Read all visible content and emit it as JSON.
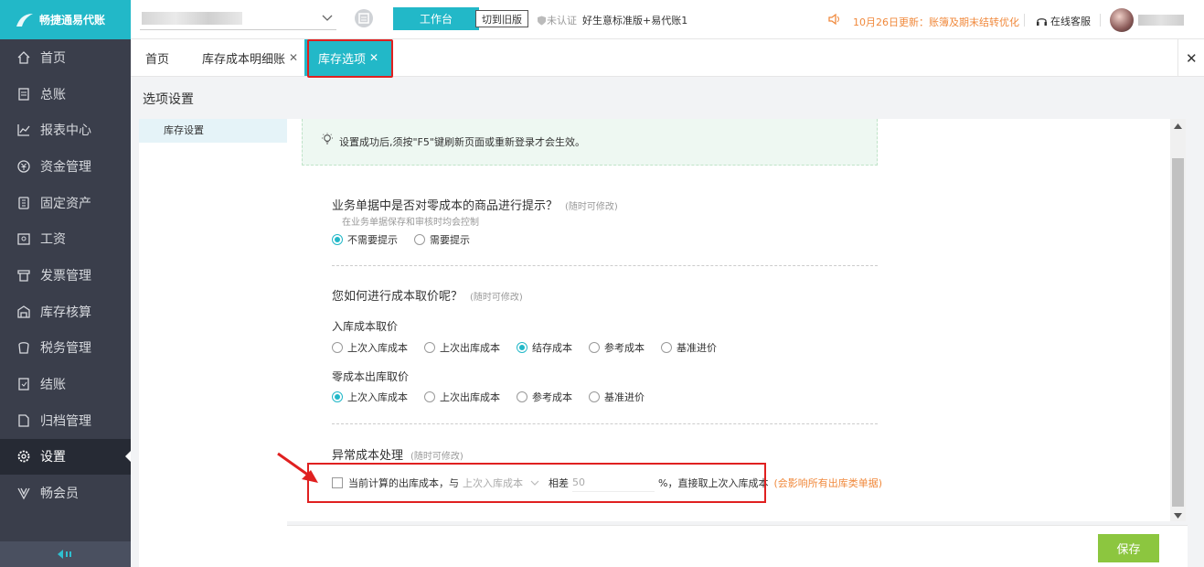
{
  "app": {
    "logo_text": "畅捷通易代账"
  },
  "sidebar": {
    "items": [
      {
        "label": "首页",
        "icon": "home-icon"
      },
      {
        "label": "总账",
        "icon": "ledger-icon"
      },
      {
        "label": "报表中心",
        "icon": "chart-icon"
      },
      {
        "label": "资金管理",
        "icon": "money-icon"
      },
      {
        "label": "固定资产",
        "icon": "asset-icon"
      },
      {
        "label": "工资",
        "icon": "salary-icon"
      },
      {
        "label": "发票管理",
        "icon": "invoice-icon"
      },
      {
        "label": "库存核算",
        "icon": "warehouse-icon"
      },
      {
        "label": "税务管理",
        "icon": "tax-icon"
      },
      {
        "label": "结账",
        "icon": "close-account-icon"
      },
      {
        "label": "归档管理",
        "icon": "archive-icon"
      },
      {
        "label": "设置",
        "icon": "gear-icon",
        "active": true
      },
      {
        "label": "畅会员",
        "icon": "vip-icon"
      }
    ]
  },
  "header": {
    "workbench": "工作台",
    "old_version": "切到旧版",
    "cert": "未认证",
    "edition": "好生意标准版+易代账1",
    "notice": "10月26日更新：账簿及期末结转优化",
    "support": "在线客服"
  },
  "tabs": [
    {
      "label": "首页"
    },
    {
      "label": "库存成本明细账"
    },
    {
      "label": "库存选项",
      "active": true
    }
  ],
  "page": {
    "title": "选项设置"
  },
  "menu": {
    "items": [
      {
        "label": "库存设置"
      }
    ]
  },
  "tip": "设置成功后,须按\"F5\"键刷新页面或重新登录才会生效。",
  "section1": {
    "title": "业务单据中是否对零成本的商品进行提示？",
    "hint": "(随时可修改)",
    "sub_hint": "在业务单据保存和审核时均会控制",
    "options": [
      "不需要提示",
      "需要提示"
    ]
  },
  "section2": {
    "title": "您如何进行成本取价呢？",
    "hint": "(随时可修改)",
    "inbound_label": "入库成本取价",
    "inbound_options": [
      "上次入库成本",
      "上次出库成本",
      "结存成本",
      "参考成本",
      "基准进价"
    ],
    "zero_label": "零成本出库取价",
    "zero_options": [
      "上次入库成本",
      "上次出库成本",
      "参考成本",
      "基准进价"
    ]
  },
  "section3": {
    "title": "异常成本处理",
    "hint": "(随时可修改)",
    "text1": "当前计算的出库成本，与",
    "select_value": "上次入库成本",
    "text2": "相差",
    "input_value": "50",
    "text3": "%，直接取上次入库成本",
    "warning": "(会影响所有出库类单据)"
  },
  "footer": {
    "save": "保存"
  }
}
